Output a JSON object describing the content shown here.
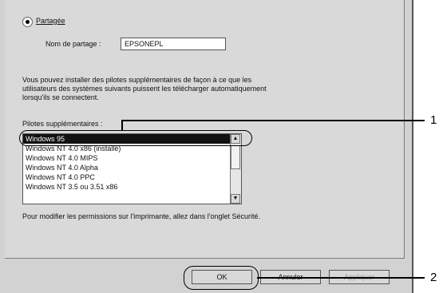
{
  "share": {
    "radio_label": "Partagée",
    "name_label": "Nom de partage :",
    "name_value": "EPSONEPL"
  },
  "description": {
    "line1": "Vous pouvez installer des pilotes supplémentaires de façon à ce que les",
    "line2": "utilisateurs des systèmes suivants puissent les télécharger automatiquement",
    "line3": "lorsqu'ils se connectent."
  },
  "drivers": {
    "label": "Pilotes supplémentaires :",
    "items": [
      {
        "label": "Windows 95",
        "selected": true
      },
      {
        "label": "Windows NT 4.0 x86 (installé)",
        "selected": false
      },
      {
        "label": "Windows NT 4.0 MIPS",
        "selected": false
      },
      {
        "label": "Windows NT 4.0 Alpha",
        "selected": false
      },
      {
        "label": "Windows NT 4.0 PPC",
        "selected": false
      },
      {
        "label": "Windows NT 3.5 ou 3.51 x86",
        "selected": false
      }
    ]
  },
  "permissions_note": "Pour modifier les permissions sur l'imprimante, allez dans l'onglet Sécurité.",
  "buttons": {
    "ok": "OK",
    "cancel": "Annuler",
    "apply": "Appliquer"
  },
  "callouts": {
    "one": "1",
    "two": "2"
  }
}
